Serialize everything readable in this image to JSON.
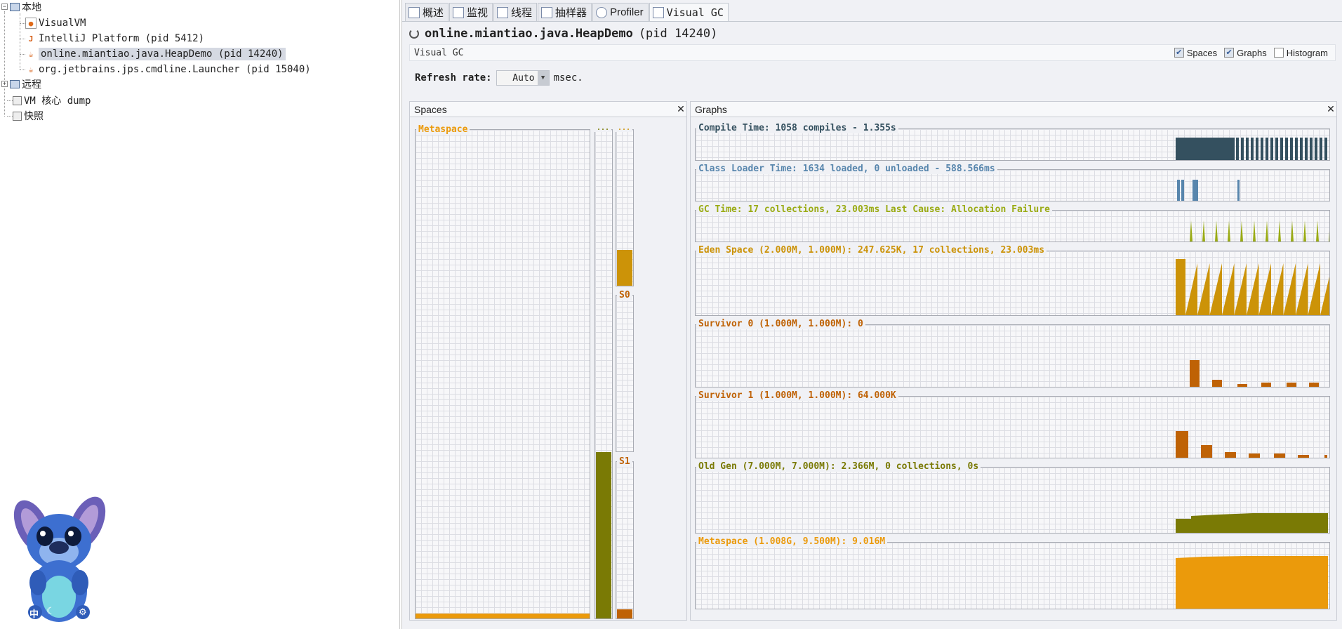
{
  "tree": {
    "local": "本地",
    "local_items": [
      {
        "label": "VisualVM"
      },
      {
        "label": "IntelliJ Platform (pid 5412)"
      },
      {
        "label": "online.miantiao.java.HeapDemo (pid 14240)"
      },
      {
        "label": "org.jetbrains.jps.cmdline.Launcher (pid 15040)"
      }
    ],
    "remote": "远程",
    "coredump": "VM 核心 dump",
    "snapshot": "快照"
  },
  "mascot_badges": {
    "left": "中",
    "right": "⚙"
  },
  "tabs": [
    {
      "label": "概述"
    },
    {
      "label": "监视"
    },
    {
      "label": "线程"
    },
    {
      "label": "抽样器"
    },
    {
      "label": "Profiler"
    },
    {
      "label": "Visual GC"
    }
  ],
  "app": {
    "name": "online.miantiao.java.HeapDemo",
    "pid": "(pid 14240)"
  },
  "visualgc": {
    "title": "Visual GC",
    "options": [
      {
        "label": "Spaces",
        "checked": true
      },
      {
        "label": "Graphs",
        "checked": true
      },
      {
        "label": "Histogram",
        "checked": false
      }
    ]
  },
  "refresh": {
    "label": "Refresh rate:",
    "value": "Auto",
    "unit": "msec."
  },
  "spaces": {
    "header": "Spaces",
    "metaspace": "Metaspace",
    "old_label": "...",
    "eden_label": "...",
    "s0": "S0",
    "s1": "S1",
    "metaspace_fill": 0.01,
    "old_fill": 0.34,
    "eden_fill": 0.23,
    "s0_fill": 0.0,
    "s1_fill": 0.06
  },
  "graphs": {
    "header": "Graphs",
    "rows": [
      {
        "label": "Compile Time: 1058 compiles - 1.355s",
        "color": "#34505f"
      },
      {
        "label": "Class Loader Time: 1634 loaded, 0 unloaded - 588.566ms",
        "color": "#5886ad"
      },
      {
        "label": "GC Time: 17 collections, 23.003ms Last Cause: Allocation Failure",
        "color": "#9aab14"
      },
      {
        "label": "Eden Space (2.000M, 1.000M): 247.625K, 17 collections, 23.003ms",
        "color": "#cc9308"
      },
      {
        "label": "Survivor 0 (1.000M, 1.000M): 0",
        "color": "#bf6205"
      },
      {
        "label": "Survivor 1 (1.000M, 1.000M): 64.000K",
        "color": "#bf6205"
      },
      {
        "label": "Old Gen (7.000M, 7.000M): 2.366M, 0 collections, 0s",
        "color": "#7a7a05"
      },
      {
        "label": "Metaspace (1.008G, 9.500M): 9.016M",
        "color": "#eb9a0b"
      }
    ]
  },
  "colors": {
    "metaspace": "#eb9a0b",
    "old": "#7a7a05",
    "eden": "#cc9308",
    "survivor": "#bf6205"
  }
}
